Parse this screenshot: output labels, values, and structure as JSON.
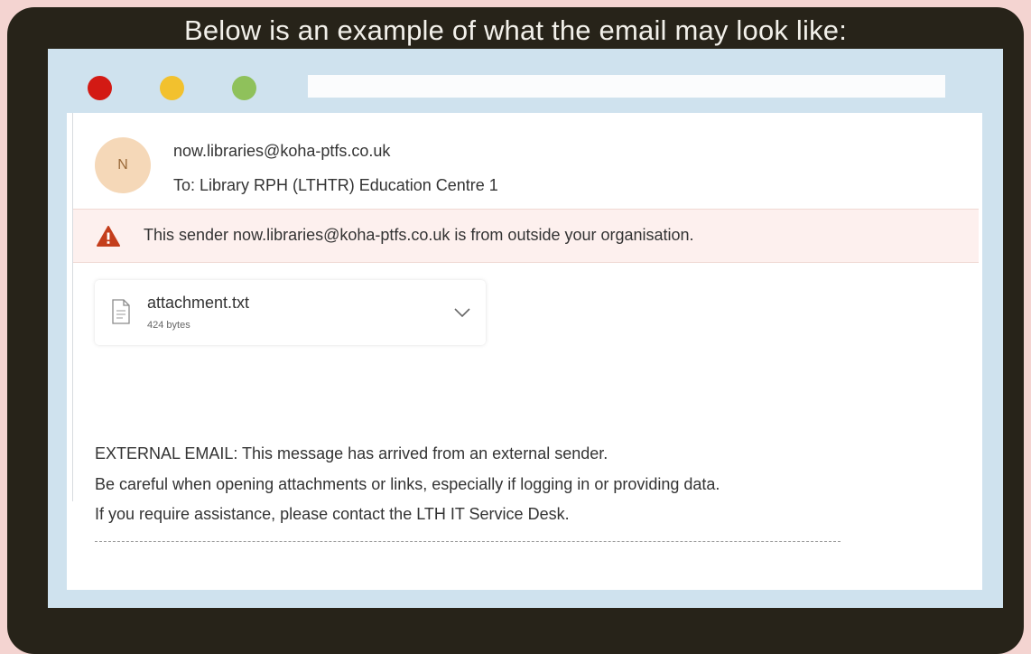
{
  "heading": "Below is an example of what the email may look like:",
  "email": {
    "avatar_initial": "N",
    "sender": "now.libraries@koha-ptfs.co.uk",
    "recipients": "To:  Library RPH (LTHTR) Education Centre 1",
    "external_warning": "This sender now.libraries@koha-ptfs.co.uk is from outside your organisation.",
    "attachment": {
      "name": "attachment.txt",
      "size": "424 bytes"
    },
    "body_lines": [
      "EXTERNAL EMAIL: This message has arrived from an external sender.",
      "Be careful when opening attachments or links, especially if logging in or providing data.",
      "If you require assistance, please contact the LTH IT Service Desk."
    ]
  },
  "icons": {
    "warning": "warning-triangle-icon",
    "file": "file-icon",
    "chevron": "chevron-down-icon"
  },
  "colors": {
    "background": "#f4d4d1",
    "device_frame": "#272319",
    "window_chrome": "#cfe2ee",
    "close_dot": "#d31a14",
    "minimize_dot": "#f2c12e",
    "maximize_dot": "#8fc15b",
    "warning_banner": "#fdf0ee",
    "warning_icon": "#c43e1c",
    "avatar": "#f5d8b8"
  }
}
